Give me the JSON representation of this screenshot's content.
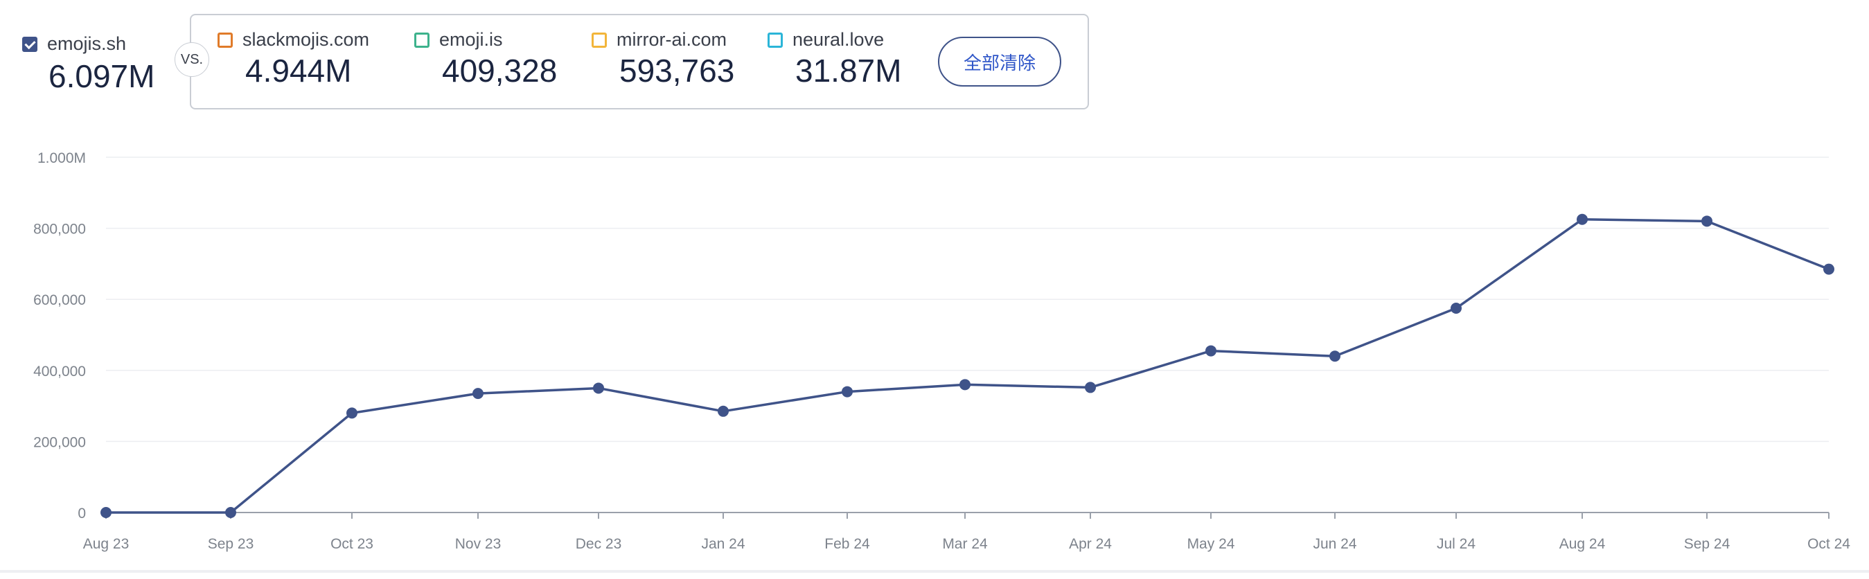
{
  "primary": {
    "name": "emojis.sh",
    "value": "6.097M",
    "color": "#3f5389"
  },
  "vs_label": "VS.",
  "competitors": [
    {
      "name": "slackmojis.com",
      "value": "4.944M",
      "color": "#e07b2a"
    },
    {
      "name": "emoji.is",
      "value": "409,328",
      "color": "#3db28c"
    },
    {
      "name": "mirror-ai.com",
      "value": "593,763",
      "color": "#f2b53a"
    },
    {
      "name": "neural.love",
      "value": "31.87M",
      "color": "#2bb5d8"
    }
  ],
  "clear_all_label": "全部清除",
  "chart_data": {
    "type": "line",
    "categories": [
      "Aug 23",
      "Sep 23",
      "Oct 23",
      "Nov 23",
      "Dec 23",
      "Jan 24",
      "Feb 24",
      "Mar 24",
      "Apr 24",
      "May 24",
      "Jun 24",
      "Jul 24",
      "Aug 24",
      "Sep 24",
      "Oct 24"
    ],
    "series": [
      {
        "name": "emojis.sh",
        "color": "#3f5389",
        "values": [
          0,
          0,
          280000,
          335000,
          350000,
          285000,
          340000,
          360000,
          352000,
          455000,
          440000,
          575000,
          825000,
          820000,
          685000
        ]
      }
    ],
    "y_ticks": [
      "0",
      "200,000",
      "400,000",
      "600,000",
      "800,000",
      "1.000M"
    ],
    "ylim": [
      0,
      1000000
    ],
    "grid": true
  }
}
